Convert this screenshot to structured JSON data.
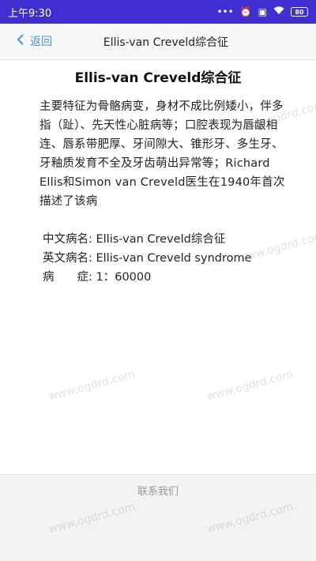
{
  "status": {
    "time": "上午9:30",
    "icons": [
      "dots-icon",
      "alarm-icon",
      "sim-icon",
      "wifi-icon",
      "battery-icon"
    ],
    "battery": "80"
  },
  "nav": {
    "back_label": "返回",
    "title": "Ellis-van Creveld综合征"
  },
  "main": {
    "title": "Ellis-van Creveld综合征",
    "description": "主要特征为骨骼病变，身材不成比例矮小，伴多指（趾）、先天性心脏病等；口腔表现为唇龈相连、唇系带肥厚、牙间隙大、锥形牙、多生牙、牙釉质发育不全及牙齿萌出异常等；Richard Ellis和Simon van Creveld医生在1940年首次描述了该病",
    "info": {
      "cn_name": "中文病名: Ellis-van Creveld综合征",
      "en_name": "英文病名: Ellis-van Creveld syndrome",
      "incidence": "病　　症: 1：60000"
    }
  },
  "footer": {
    "contact": "联系我们"
  },
  "watermark": "www.ogdrd.com",
  "colors": {
    "statusbar": "#3f2fd0",
    "link": "#4a90e2"
  }
}
